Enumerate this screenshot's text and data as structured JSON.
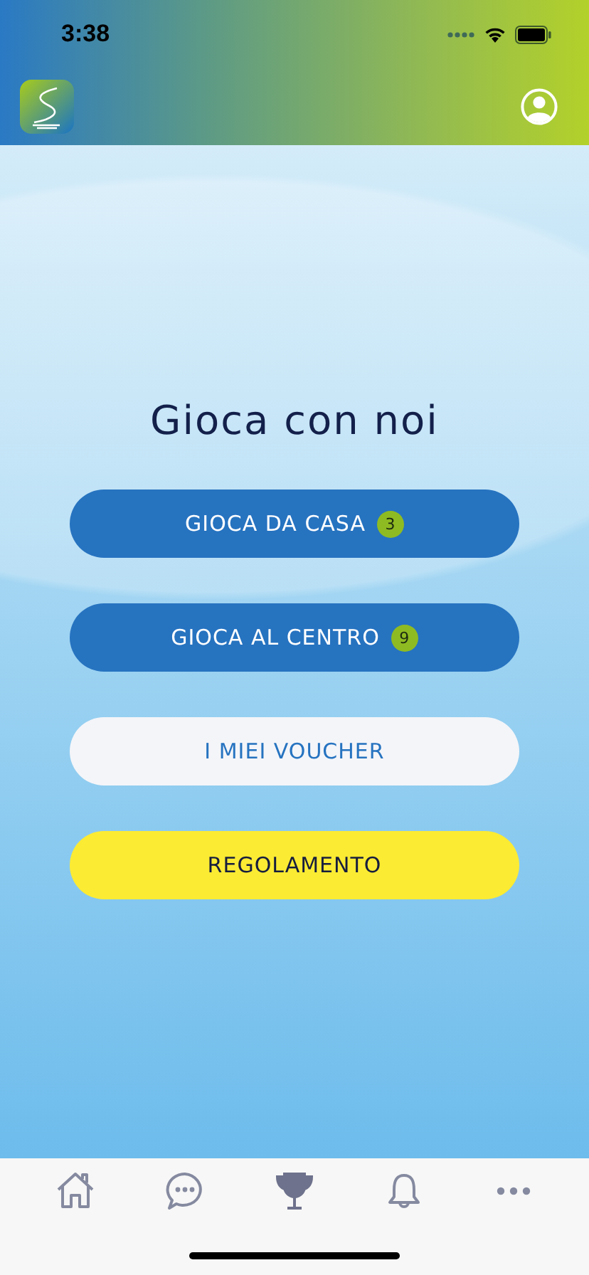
{
  "status_bar": {
    "time": "3:38"
  },
  "title": "Gioca con noi",
  "buttons": [
    {
      "label": "GIOCA DA CASA",
      "kind": "primary",
      "badge": "3"
    },
    {
      "label": "GIOCA AL CENTRO",
      "kind": "primary",
      "badge": "9"
    },
    {
      "label": "I MIEI VOUCHER",
      "kind": "light"
    },
    {
      "label": "REGOLAMENTO",
      "kind": "accent"
    }
  ],
  "tab_bar": [
    {
      "kind": "home",
      "selected": false
    },
    {
      "kind": "chat",
      "selected": false
    },
    {
      "kind": "trophy",
      "selected": true
    },
    {
      "kind": "bell",
      "selected": false
    },
    {
      "kind": "more",
      "selected": false
    }
  ]
}
